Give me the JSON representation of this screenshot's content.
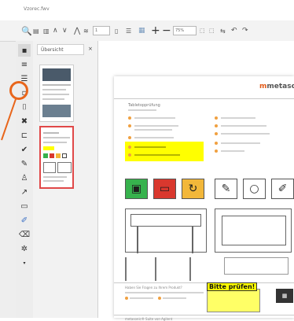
{
  "window": {
    "title": "Vzorec.fwv"
  },
  "toolbar": {
    "page_value": "1",
    "zoom_value": "75%",
    "icons": [
      "search-icon",
      "save-icon",
      "print-icon",
      "up-icon",
      "down-icon",
      "first-page-icon",
      "last-page-icon",
      "page-icon",
      "zoom-icon",
      "zoom-in-icon",
      "zoom-out-icon",
      "fit-icon",
      "rotate-icon",
      "undo-icon",
      "redo-icon"
    ]
  },
  "sidebar": {
    "tab_label": "Übersicht",
    "tab_close": "×"
  },
  "document": {
    "logo_text": "metasc",
    "logo_accent": "m",
    "title": "Tabletopprüfung",
    "bottom_heading": "Haben Sie Fragen zu Ihrem Produkt?",
    "footer_heading": "metasonic® Suite von Agilent",
    "sticky_label": "Bitte prüfen!",
    "icons_row": [
      "calendar-icon",
      "monitor-icon",
      "refresh-icon",
      "pen-icon",
      "circle-icon",
      "marker-icon"
    ]
  },
  "colors": {
    "accent": "#e8661c",
    "highlight": "#ffff00",
    "green": "#37b24d",
    "red": "#d9382e",
    "orange": "#f2b73a"
  }
}
